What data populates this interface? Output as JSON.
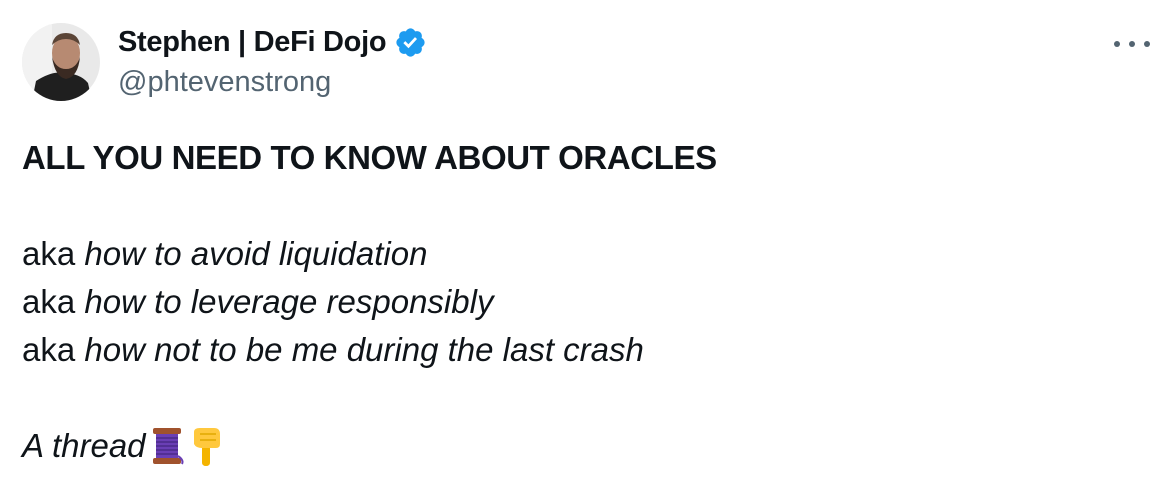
{
  "author": {
    "display_name": "Stephen | DeFi Dojo",
    "handle": "@phtevenstrong",
    "verified": true
  },
  "tweet": {
    "heading": "ALL YOU NEED TO KNOW ABOUT ORACLES",
    "lines": [
      {
        "prefix": "aka ",
        "italic": "how to avoid liquidation"
      },
      {
        "prefix": "aka ",
        "italic": "how to leverage responsibly"
      },
      {
        "prefix": "aka ",
        "italic": "how not to be me during the last crash"
      }
    ],
    "thread_text": "A thread",
    "emojis": [
      "spool-of-thread-icon",
      "pointing-down-icon"
    ]
  },
  "colors": {
    "text": "#0f1419",
    "secondary": "#536471",
    "verified_blue": "#1d9bf0"
  },
  "icons": {
    "more": "more-options-icon",
    "verified": "verified-badge-icon"
  }
}
